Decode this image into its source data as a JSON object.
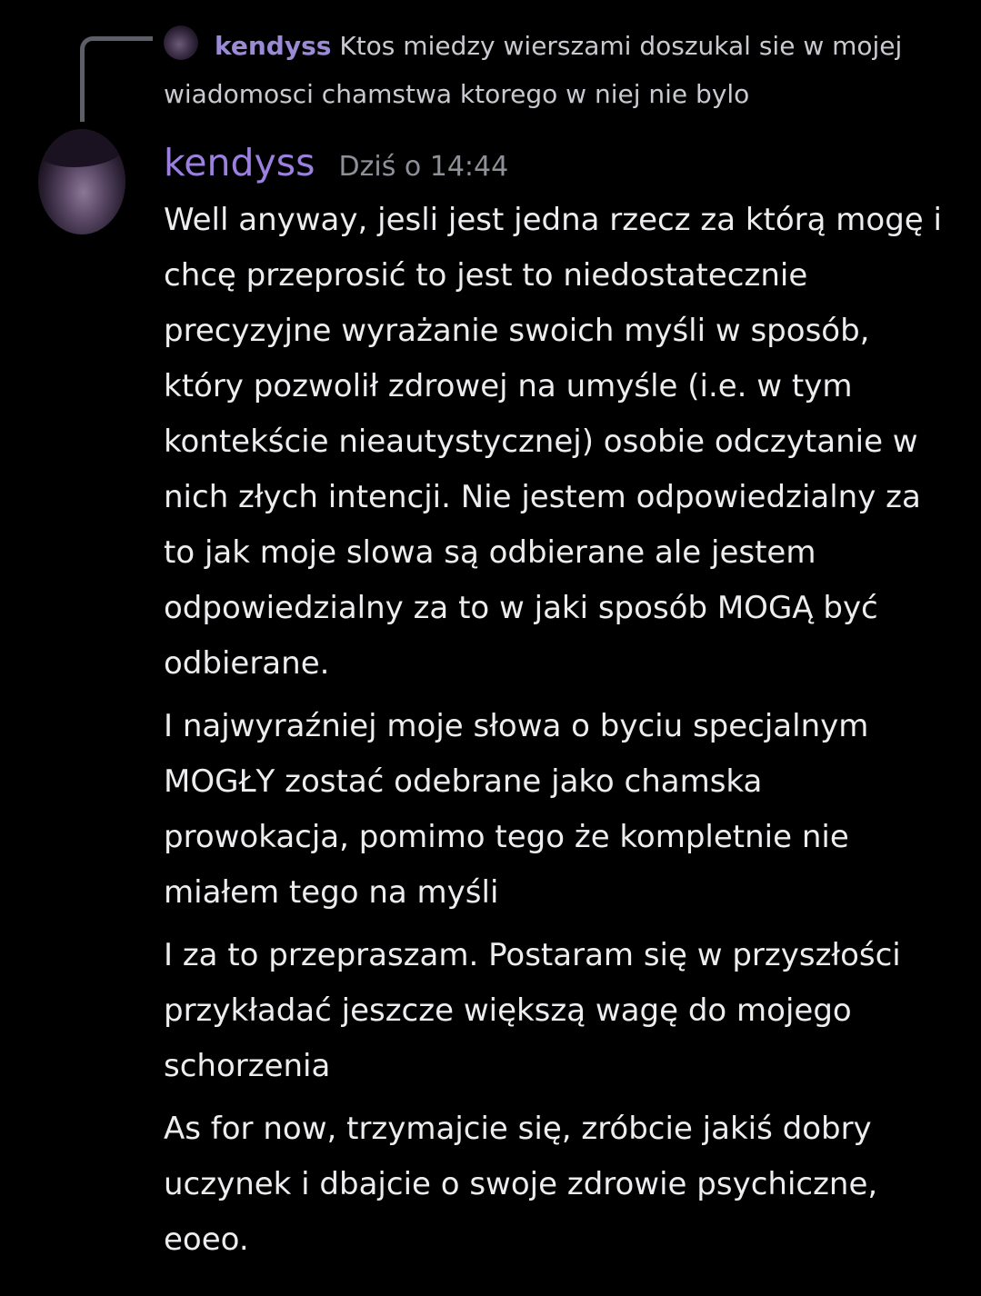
{
  "reply": {
    "author": "kendyss",
    "text": "Ktos miedzy wierszami doszukal sie w mojej wiadomosci chamstwa ktorego w niej nie bylo"
  },
  "message": {
    "author": "kendyss",
    "timestamp": "Dziś o 14:44",
    "paragraphs": [
      "Well anyway, jesli jest jedna rzecz za którą mogę i chcę przeprosić to jest to niedostatecznie precyzyjne wyrażanie swoich myśli w sposób, który pozwolił zdrowej na umyśle (i.e. w tym kontekście nieautystycznej) osobie odczytanie w nich złych intencji. Nie jestem odpowiedzialny za to jak moje slowa są odbierane ale jestem odpowiedzialny za to w jaki sposób MOGĄ być odbierane.",
      "I najwyraźniej moje słowa o byciu specjalnym MOGŁY zostać odebrane jako chamska prowokacja, pomimo tego że kompletnie nie miałem tego na myśli",
      "I za to przepraszam. Postaram się w przyszłości przykładać jeszcze większą wagę do mojego schorzenia",
      "As for now, trzymajcie się, zróbcie jakiś dobry uczynek i dbajcie o swoje zdrowie psychiczne, eoeo."
    ]
  },
  "colors": {
    "background": "#000000",
    "author": "#9b80e0",
    "timestamp": "#8e9099",
    "text": "#ededf0"
  }
}
